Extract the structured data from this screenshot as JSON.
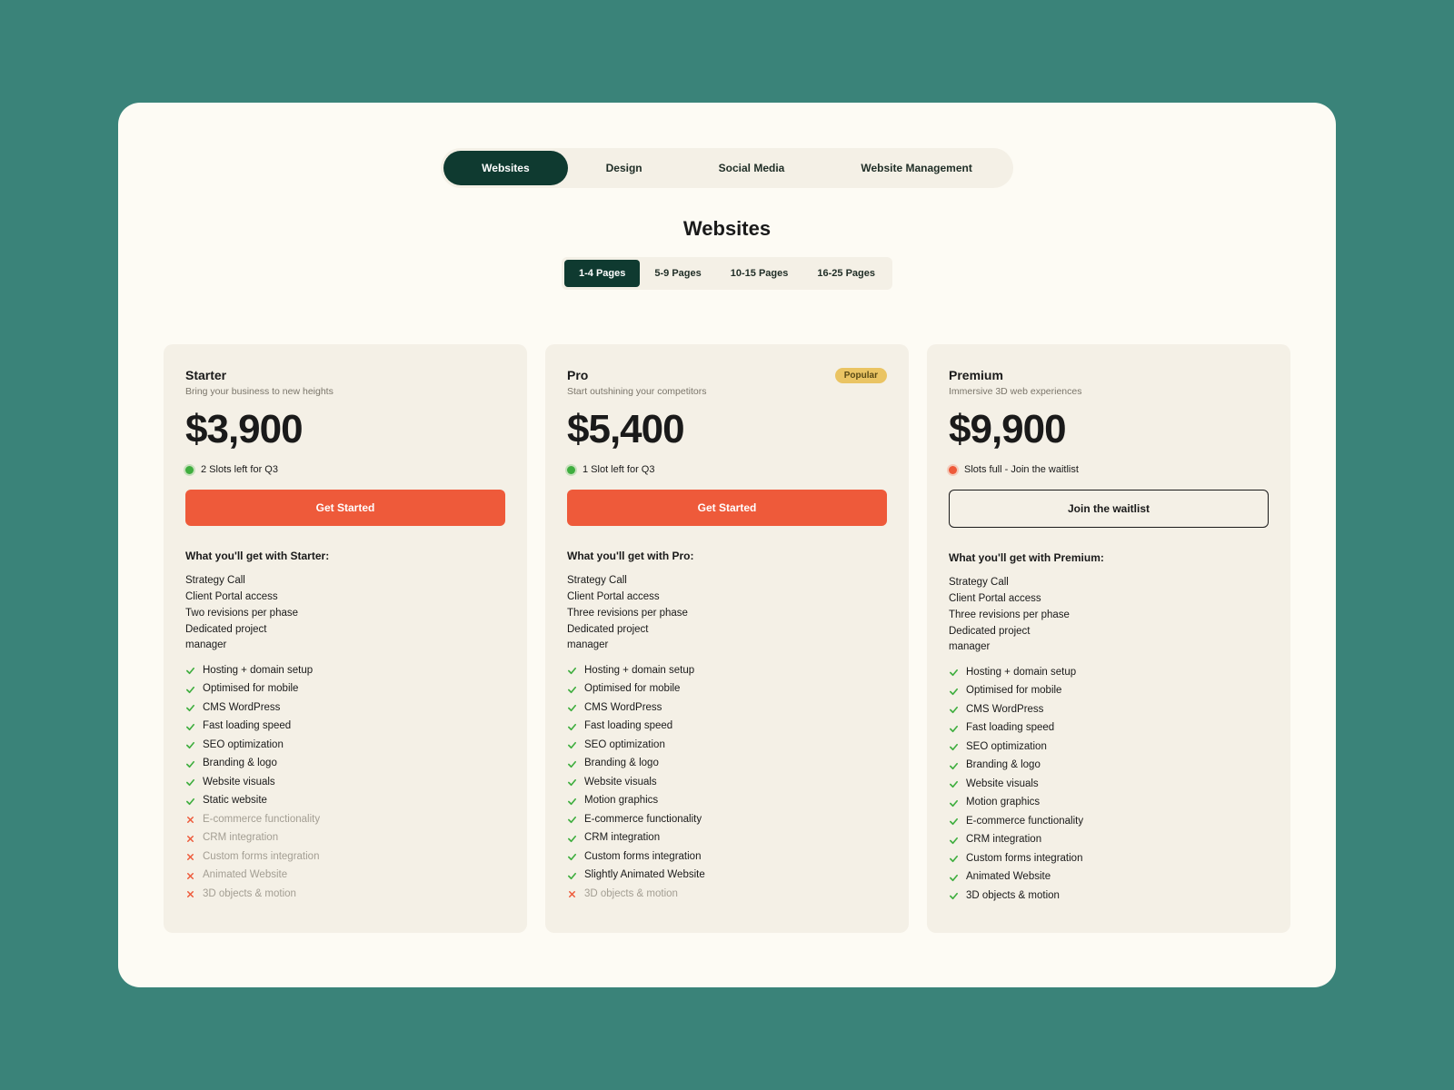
{
  "nav": {
    "tabs": [
      "Websites",
      "Design",
      "Social Media",
      "Website Management"
    ],
    "active": 0
  },
  "section_title": "Websites",
  "subtabs": {
    "items": [
      "1-4 Pages",
      "5-9 Pages",
      "10-15 Pages",
      "16-25 Pages"
    ],
    "active": 0
  },
  "colors": {
    "green": "#3fae3f",
    "red": "#ee5a3a",
    "accent": "#ee5a3a",
    "dark": "#0f3a30",
    "badge": "#eac463"
  },
  "plans": [
    {
      "name": "Starter",
      "tagline": "Bring your business to new heights",
      "price": "$3,900",
      "slot_status": "green",
      "slot_text": "2 Slots left for Q3",
      "cta_label": "Get Started",
      "cta_style": "primary",
      "badge": null,
      "included_heading": "What you'll get with Starter:",
      "base": [
        "Strategy Call",
        "Client Portal access",
        "Two revisions per phase",
        "Dedicated project",
        "manager"
      ],
      "features": [
        {
          "on": true,
          "label": "Hosting + domain setup"
        },
        {
          "on": true,
          "label": "Optimised for mobile"
        },
        {
          "on": true,
          "label": "CMS WordPress"
        },
        {
          "on": true,
          "label": "Fast loading speed"
        },
        {
          "on": true,
          "label": "SEO optimization"
        },
        {
          "on": true,
          "label": "Branding & logo"
        },
        {
          "on": true,
          "label": "Website visuals"
        },
        {
          "on": true,
          "label": "Static website"
        },
        {
          "on": false,
          "label": "E-commerce functionality"
        },
        {
          "on": false,
          "label": "CRM integration"
        },
        {
          "on": false,
          "label": "Custom forms integration"
        },
        {
          "on": false,
          "label": "Animated Website"
        },
        {
          "on": false,
          "label": "3D objects & motion"
        }
      ]
    },
    {
      "name": "Pro",
      "tagline": "Start outshining your competitors",
      "price": "$5,400",
      "slot_status": "green",
      "slot_text": "1 Slot left for Q3",
      "cta_label": "Get Started",
      "cta_style": "primary",
      "badge": "Popular",
      "included_heading": "What you'll get with Pro:",
      "base": [
        "Strategy Call",
        "Client Portal access",
        "Three revisions per phase",
        "Dedicated project",
        "manager"
      ],
      "features": [
        {
          "on": true,
          "label": "Hosting + domain setup"
        },
        {
          "on": true,
          "label": "Optimised for mobile"
        },
        {
          "on": true,
          "label": "CMS WordPress"
        },
        {
          "on": true,
          "label": "Fast loading speed"
        },
        {
          "on": true,
          "label": "SEO optimization"
        },
        {
          "on": true,
          "label": "Branding & logo"
        },
        {
          "on": true,
          "label": "Website visuals"
        },
        {
          "on": true,
          "label": "Motion graphics"
        },
        {
          "on": true,
          "label": "E-commerce functionality"
        },
        {
          "on": true,
          "label": "CRM integration"
        },
        {
          "on": true,
          "label": "Custom forms integration"
        },
        {
          "on": true,
          "label": "Slightly Animated Website"
        },
        {
          "on": false,
          "label": "3D objects & motion"
        }
      ]
    },
    {
      "name": "Premium",
      "tagline": "Immersive 3D web experiences",
      "price": "$9,900",
      "slot_status": "red",
      "slot_text": "Slots full - Join the waitlist",
      "cta_label": "Join the waitlist",
      "cta_style": "outline",
      "badge": null,
      "included_heading": "What you'll get with Premium:",
      "base": [
        "Strategy Call",
        "Client Portal access",
        "Three revisions per phase",
        "Dedicated project",
        "manager"
      ],
      "features": [
        {
          "on": true,
          "label": "Hosting + domain setup"
        },
        {
          "on": true,
          "label": "Optimised for mobile"
        },
        {
          "on": true,
          "label": "CMS WordPress"
        },
        {
          "on": true,
          "label": "Fast loading speed"
        },
        {
          "on": true,
          "label": "SEO optimization"
        },
        {
          "on": true,
          "label": "Branding & logo"
        },
        {
          "on": true,
          "label": "Website visuals"
        },
        {
          "on": true,
          "label": "Motion graphics"
        },
        {
          "on": true,
          "label": "E-commerce functionality"
        },
        {
          "on": true,
          "label": "CRM integration"
        },
        {
          "on": true,
          "label": "Custom forms integration"
        },
        {
          "on": true,
          "label": "Animated Website"
        },
        {
          "on": true,
          "label": "3D objects & motion"
        }
      ]
    }
  ]
}
